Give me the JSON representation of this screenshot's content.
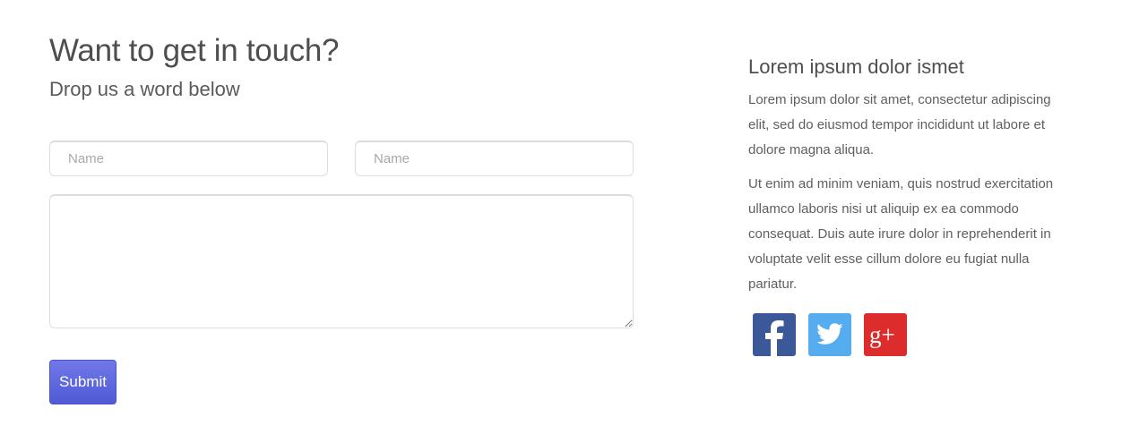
{
  "contact": {
    "heading": "Want to get in touch?",
    "subheading": "Drop us a word below",
    "fields": {
      "name_first_placeholder": "Name",
      "name_second_placeholder": "Name",
      "message_placeholder": ""
    },
    "submit_label": "Submit"
  },
  "info": {
    "title": "Lorem ipsum dolor ismet",
    "paragraphs": [
      "Lorem ipsum dolor sit amet, consectetur adipiscing elit, sed do eiusmod tempor incididunt ut labore et dolore magna aliqua.",
      "Ut enim ad minim veniam, quis nostrud exercitation ullamco laboris nisi ut aliquip ex ea commodo consequat. Duis aute irure dolor in reprehenderit in voluptate velit esse cillum dolore eu fugiat nulla pariatur."
    ]
  },
  "social": [
    {
      "icon": "facebook-icon",
      "color": "#3b5998"
    },
    {
      "icon": "twitter-icon",
      "color": "#55acee"
    },
    {
      "icon": "google-plus-icon",
      "color": "#dd2c2c"
    }
  ],
  "colors": {
    "accent": "#5a63dd",
    "text": "#555555"
  }
}
